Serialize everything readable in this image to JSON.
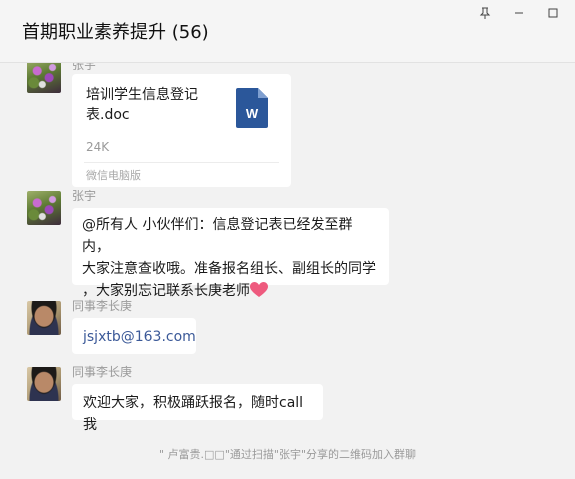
{
  "window": {
    "title": "首期职业素养提升 (56)",
    "controls": {
      "pin": "pin-icon",
      "minimize": "minimize-icon",
      "maximize": "maximize-icon"
    }
  },
  "messages": [
    {
      "sender": "张宇",
      "type": "file",
      "file": {
        "name": "培训学生信息登记表.doc",
        "size": "24K",
        "source": "微信电脑版",
        "icon": "word-doc-icon"
      }
    },
    {
      "sender": "张宇",
      "type": "text",
      "lines": [
        "@所有人 小伙伴们：信息登记表已经发至群内，",
        "大家注意查收哦。准备报名组长、副组长的同学",
        "，大家别忘记联系长庚老师"
      ],
      "emoji": "heart-icon"
    },
    {
      "sender": "同事李长庚",
      "type": "text",
      "text": "jsjxtb@163.com"
    },
    {
      "sender": "同事李长庚",
      "type": "text",
      "text": "欢迎大家，积极踊跃报名，随时call我"
    }
  ],
  "system_message": "\" 卢富贵.□□\"通过扫描\"张宇\"分享的二维码加入群聊",
  "colors": {
    "background": "#f2f2f2",
    "bubble": "#ffffff",
    "link": "#3b5998",
    "word_blue": "#2b579a"
  }
}
